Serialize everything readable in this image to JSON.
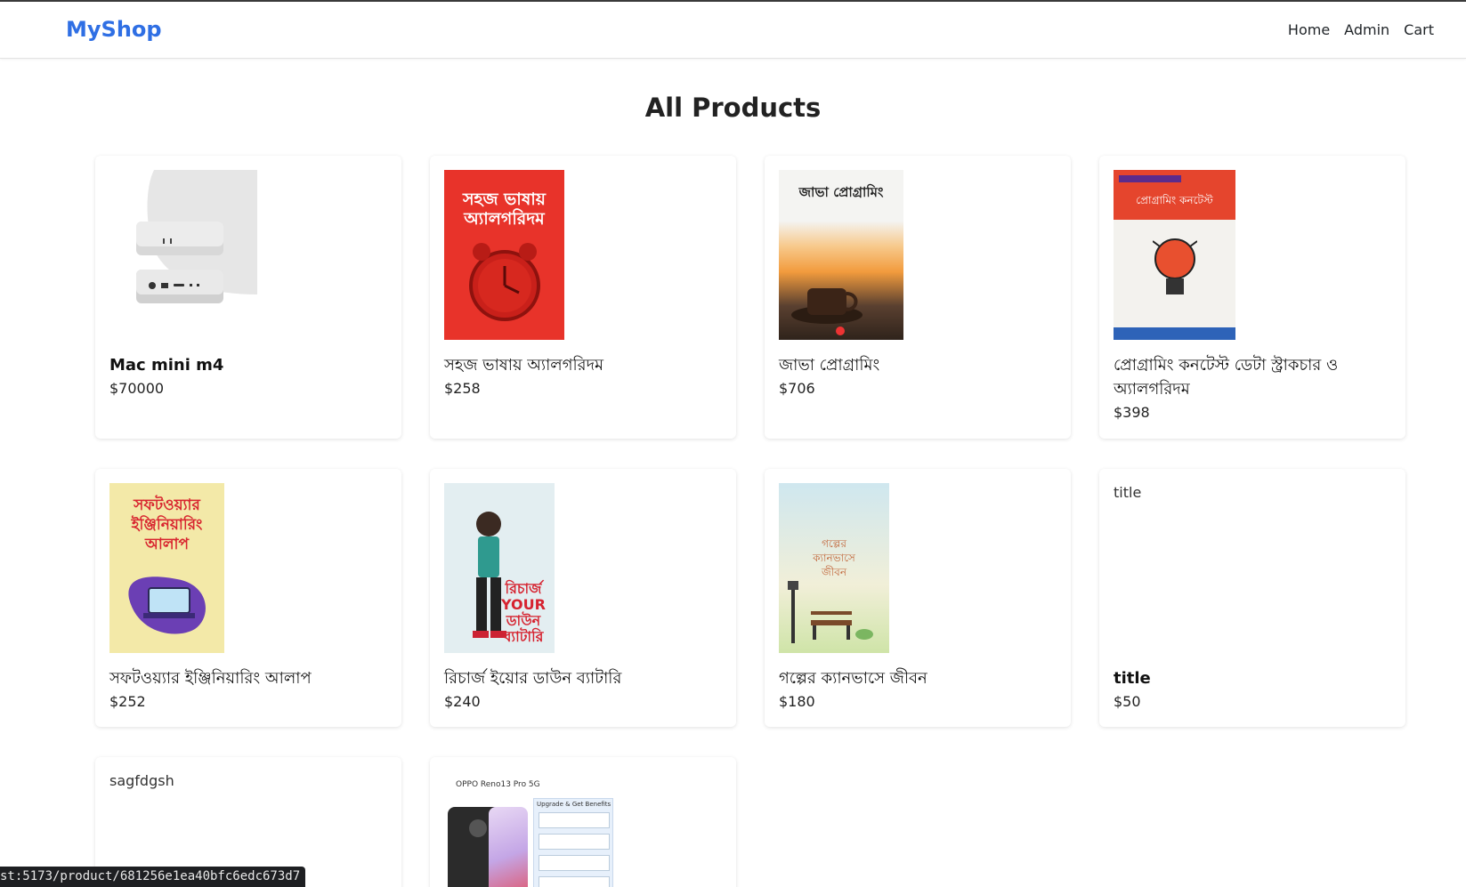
{
  "header": {
    "brand": "MyShop",
    "nav": [
      "Home",
      "Admin",
      "Cart"
    ]
  },
  "page": {
    "title": "All Products"
  },
  "products": [
    {
      "name": "Mac mini m4",
      "price": "$70000",
      "image_text": ""
    },
    {
      "name": "সহজ ভাষায় অ্যালগরিদম",
      "price": "$258",
      "image_text": "সহজ ভাষায় অ্যালগরিদম"
    },
    {
      "name": "জাভা প্রোগ্রামিং",
      "price": "$706",
      "image_text": "জাভা প্রোগ্রামিং"
    },
    {
      "name": "প্রোগ্রামিং কনটেস্ট ডেটা স্ট্রাকচার ও অ্যালগরিদম",
      "price": "$398",
      "image_text": "প্রোগ্রামিং কনটেস্ট"
    },
    {
      "name": "সফটওয়্যার ইঞ্জিনিয়ারিং আলাপ",
      "price": "$252",
      "image_text": "সফটওয়্যার ইঞ্জিনিয়ারিং আলাপ"
    },
    {
      "name": "রিচার্জ ইয়োর ডাউন ব্যাটারি",
      "price": "$240",
      "image_text": "রিচার্জ YOUR ডাউন ব্যাটারি"
    },
    {
      "name": "গল্পের ক্যানভাসে জীবন",
      "price": "$180",
      "image_text": "গল্পের ক্যানভাসে জীবন"
    },
    {
      "name": "title",
      "price": "$50",
      "image_alt": "title"
    },
    {
      "name": "",
      "price": "",
      "image_alt": "sagfdgsh"
    },
    {
      "name": "",
      "price": "",
      "image_text": "OPPO Reno13 Pro 5G",
      "image_subtext": "Upgrade & Get Benefits"
    }
  ],
  "status_bar": {
    "url": "st:5173/product/681256e1ea40bfc6edc673d7"
  },
  "colors": {
    "brand": "#2f6fe4",
    "card_shadow": "#e6e6e6"
  }
}
